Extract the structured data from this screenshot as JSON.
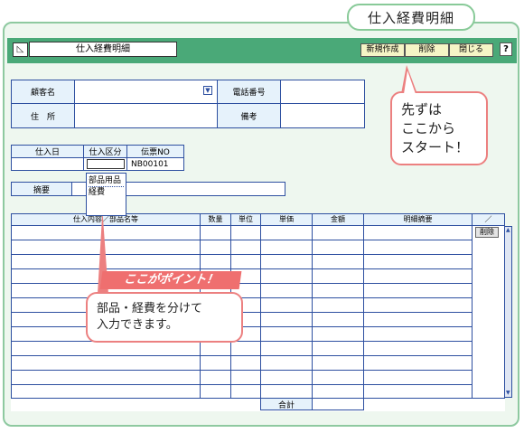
{
  "page_title": "仕入経費明細",
  "window": {
    "title": "仕入経費明細",
    "buttons": [
      "新規作成",
      "削除",
      "閉じる"
    ],
    "help": "?"
  },
  "customer": {
    "name_label": "顧客名",
    "name_value": "",
    "dropdown_arrow": "▼",
    "phone_label": "電話番号",
    "phone_value": "",
    "address_label": "住　所",
    "address_value": "",
    "note_label": "備考",
    "note_value": ""
  },
  "entry": {
    "date_label": "仕入日",
    "type_label": "仕入区分",
    "slip_label": "伝票NO",
    "date_value": "",
    "type_value": "",
    "slip_value": "NB00101",
    "summary_label": "摘要",
    "type_options": [
      "部品用品",
      "経費"
    ]
  },
  "table": {
    "columns": [
      "仕入内容／部品名等",
      "数量",
      "単位",
      "単価",
      "金額",
      "明細摘要",
      "／"
    ],
    "row_delete_label": "削除",
    "total_label": "合計",
    "rows": 12
  },
  "callouts": {
    "start": [
      "先ずは",
      "ここから",
      "スタート！"
    ],
    "point_title": "ここがポイント！",
    "point_text": [
      "部品・経費を分けて",
      "入力できます。"
    ]
  }
}
